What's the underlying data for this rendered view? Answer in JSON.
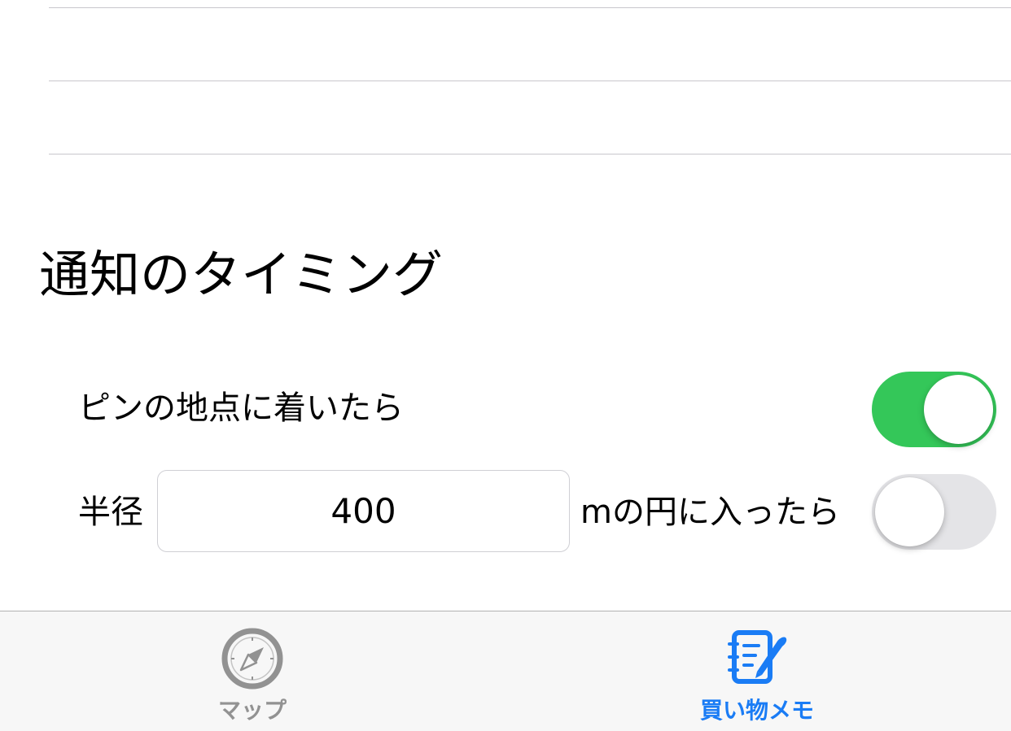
{
  "section": {
    "title": "通知のタイミング"
  },
  "options": {
    "arrive_label": "ピンの地点に着いたら",
    "arrive_toggle_on": true,
    "radius_prefix": "半径",
    "radius_value": "400",
    "radius_suffix": "mの円に入ったら",
    "radius_toggle_on": false
  },
  "tab_bar": {
    "map_label": "マップ",
    "memo_label": "買い物メモ",
    "map_icon": "compass-icon",
    "memo_icon": "notepad-pen-icon",
    "selected": "memo",
    "active_color": "#1a7cf5",
    "inactive_color": "#929292"
  },
  "colors": {
    "toggle_on": "#34c759",
    "toggle_off": "#e4e4e7"
  }
}
